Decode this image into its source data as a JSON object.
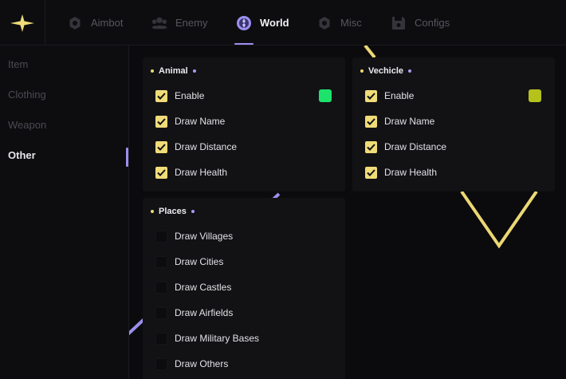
{
  "colors": {
    "accent_purple": "#9b8fef",
    "accent_yellow": "#f0dc78",
    "animal_enable_color": "#1de26b",
    "vehicle_enable_color": "#b4c21b"
  },
  "tabs": [
    {
      "label": "Aimbot",
      "icon": "gear-icon"
    },
    {
      "label": "Enemy",
      "icon": "users-icon"
    },
    {
      "label": "World",
      "icon": "globe-icon"
    },
    {
      "label": "Misc",
      "icon": "gear-icon"
    },
    {
      "label": "Configs",
      "icon": "save-icon"
    }
  ],
  "active_tab": "World",
  "sidebar": {
    "items": [
      {
        "label": "Item"
      },
      {
        "label": "Clothing"
      },
      {
        "label": "Weapon"
      },
      {
        "label": "Other"
      }
    ],
    "active": "Other"
  },
  "animal": {
    "title": "Animal",
    "options": [
      {
        "label": "Enable",
        "checked": true
      },
      {
        "label": "Draw Name",
        "checked": true
      },
      {
        "label": "Draw Distance",
        "checked": true
      },
      {
        "label": "Draw Health",
        "checked": true
      }
    ]
  },
  "vehicle": {
    "title": "Vechicle",
    "options": [
      {
        "label": "Enable",
        "checked": true
      },
      {
        "label": "Draw Name",
        "checked": true
      },
      {
        "label": "Draw Distance",
        "checked": true
      },
      {
        "label": "Draw Health",
        "checked": true
      }
    ]
  },
  "places": {
    "title": "Places",
    "options": [
      {
        "label": "Draw Villages",
        "checked": false
      },
      {
        "label": "Draw Cities",
        "checked": false
      },
      {
        "label": "Draw Castles",
        "checked": false
      },
      {
        "label": "Draw Airfields",
        "checked": false
      },
      {
        "label": "Draw Military Bases",
        "checked": false
      },
      {
        "label": "Draw Others",
        "checked": false
      }
    ]
  }
}
